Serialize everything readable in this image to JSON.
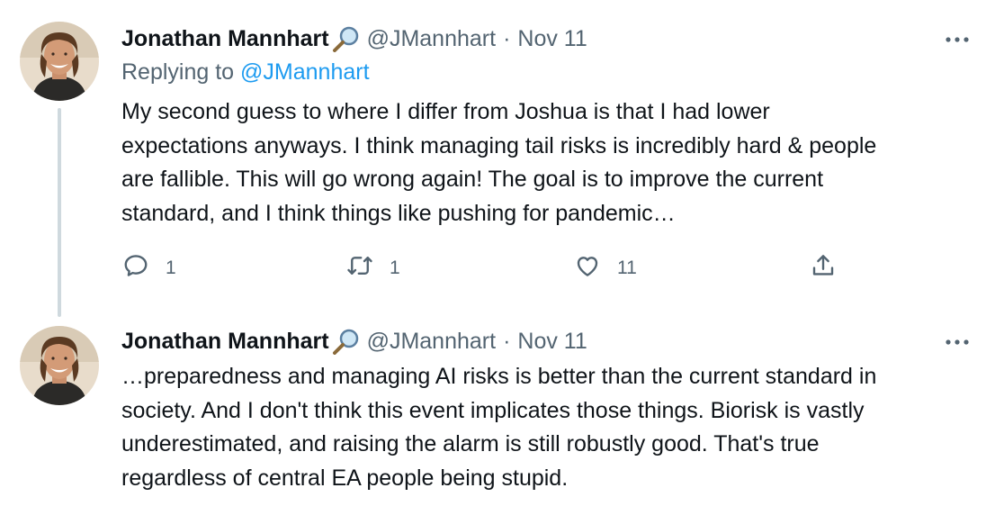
{
  "tweets": [
    {
      "author_name": "Jonathan Mannhart",
      "badge_icon": "magnifying-glass-emoji",
      "handle": "@JMannhart",
      "separator": "·",
      "date": "Nov 11",
      "replying_prefix": "Replying to",
      "replying_handle": "@JMannhart",
      "text_lines": [
        "My second guess to where I differ from Joshua is that I had lower",
        "expectations anyways. I think managing tail risks is incredibly hard & people",
        "are fallible. This will go wrong again! The goal is to improve the current",
        "standard, and I think things like pushing for pandemic…"
      ],
      "actions": {
        "reply_count": "1",
        "retweet_count": "1",
        "like_count": "11"
      }
    },
    {
      "author_name": "Jonathan Mannhart",
      "badge_icon": "magnifying-glass-emoji",
      "handle": "@JMannhart",
      "separator": "·",
      "date": "Nov 11",
      "text_lines": [
        "…preparedness and managing AI risks is better than the current standard in",
        "society. And I don't think this event implicates those things. Biorisk is vastly",
        "underestimated, and raising the alarm is still robustly good. That's true",
        "regardless of central EA people being stupid."
      ]
    }
  ],
  "colors": {
    "text_primary": "#0f1419",
    "text_secondary": "#536471",
    "link": "#1d9bf0",
    "thread_line": "#cfd9de"
  }
}
